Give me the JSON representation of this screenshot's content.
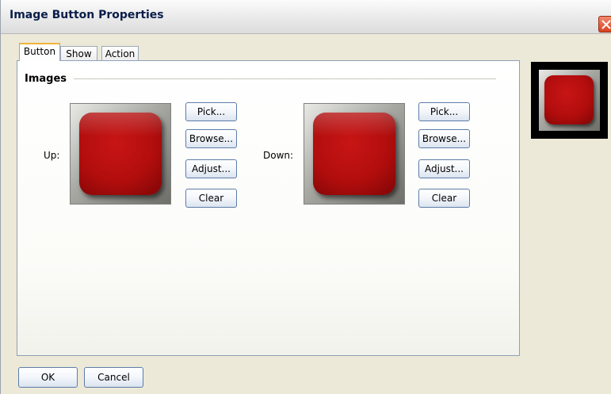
{
  "window": {
    "title": "Image Button Properties",
    "close_icon": "close-x-icon",
    "accent_color": "#d9431f"
  },
  "tabs": [
    {
      "label": "Button",
      "active": true
    },
    {
      "label": "Show",
      "active": false
    },
    {
      "label": "Action",
      "active": false
    }
  ],
  "images_group": {
    "label": "Images",
    "up": {
      "label": "Up:",
      "image_icon": "red-rounded-button-image",
      "buttons": {
        "pick": "Pick...",
        "browse": "Browse...",
        "adjust": "Adjust...",
        "clear": "Clear"
      }
    },
    "down": {
      "label": "Down:",
      "image_icon": "red-rounded-button-image",
      "buttons": {
        "pick": "Pick...",
        "browse": "Browse...",
        "adjust": "Adjust...",
        "clear": "Clear"
      }
    }
  },
  "preview": {
    "image_icon": "red-rounded-button-image",
    "colors": {
      "frame": "#000000",
      "button": "#b20d0d"
    }
  },
  "footer": {
    "ok_label": "OK",
    "cancel_label": "Cancel"
  }
}
